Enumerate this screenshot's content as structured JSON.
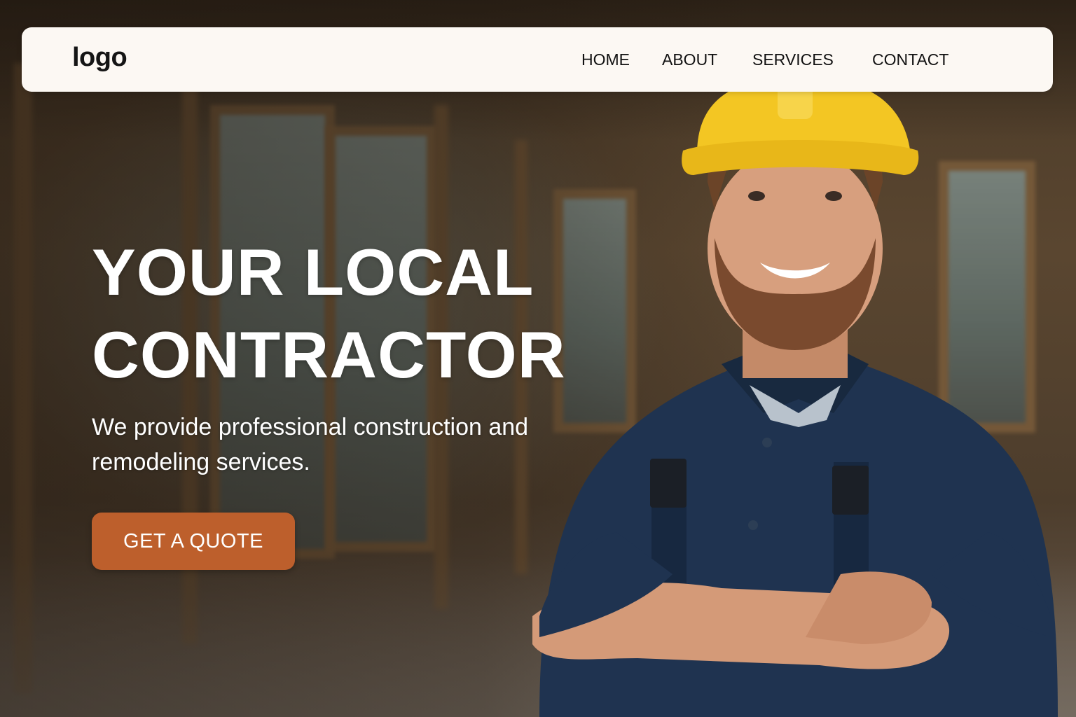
{
  "nav": {
    "logo": "logo",
    "items": [
      {
        "label": "HOME"
      },
      {
        "label": "ABOUT"
      },
      {
        "label": "SERVICES"
      },
      {
        "label": "CONTACT"
      }
    ]
  },
  "hero": {
    "title_line1": "YOUR LOCAL",
    "title_line2": "CONTRACTOR",
    "subtitle": "We provide professional construction and remodeling services.",
    "cta_label": "GET A QUOTE"
  },
  "colors": {
    "navbar_bg": "#fcf8f3",
    "cta_bg": "#bd5f2c",
    "hardhat": "#f3c623",
    "shirt": "#1f3350"
  }
}
